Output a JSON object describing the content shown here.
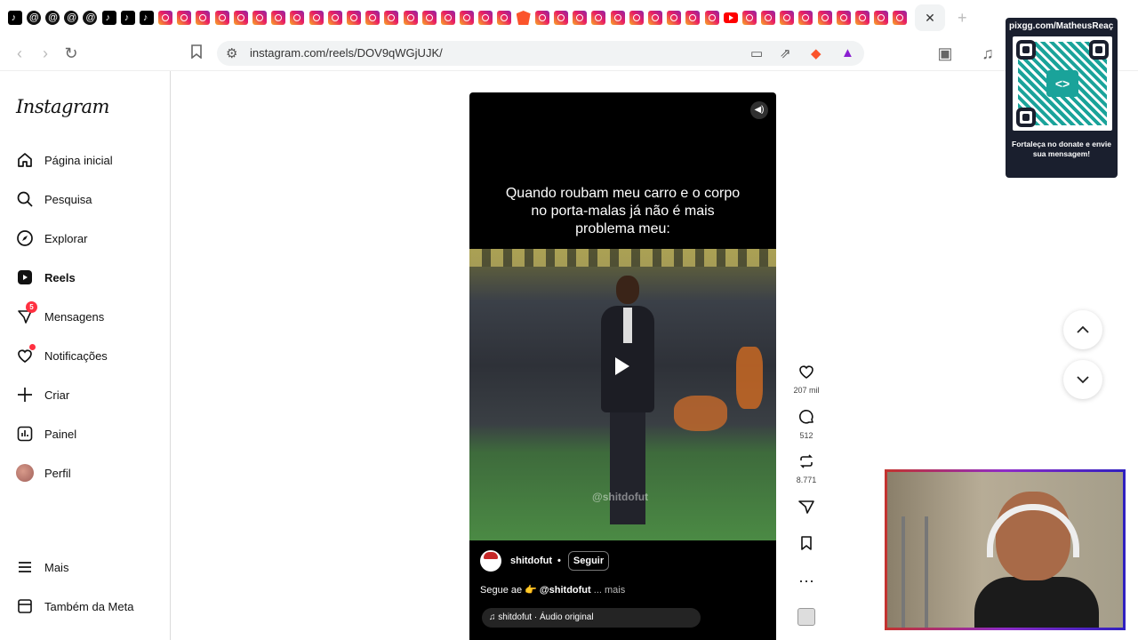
{
  "browser": {
    "tabs_icons": [
      "tiktok",
      "threads",
      "threads",
      "threads",
      "threads",
      "tiktok",
      "tiktok",
      "tiktok",
      "instagram",
      "instagram",
      "instagram",
      "instagram",
      "instagram",
      "instagram",
      "instagram",
      "instagram",
      "instagram",
      "instagram",
      "instagram",
      "instagram",
      "instagram",
      "instagram",
      "instagram",
      "instagram",
      "instagram",
      "instagram",
      "instagram",
      "brave",
      "instagram",
      "instagram",
      "instagram",
      "instagram",
      "instagram",
      "instagram",
      "instagram",
      "instagram",
      "instagram",
      "instagram",
      "youtube",
      "instagram",
      "instagram",
      "instagram",
      "instagram",
      "instagram",
      "instagram",
      "instagram",
      "instagram",
      "instagram"
    ],
    "close_tab": "✕",
    "new_tab": "+",
    "url": "instagram.com/reels/DOV9qWGjUJK/"
  },
  "sidebar": {
    "logo": "Instagram",
    "items": [
      {
        "label": "Página inicial",
        "icon": "home-icon"
      },
      {
        "label": "Pesquisa",
        "icon": "search-icon"
      },
      {
        "label": "Explorar",
        "icon": "compass-icon"
      },
      {
        "label": "Reels",
        "icon": "reels-icon"
      },
      {
        "label": "Mensagens",
        "icon": "messenger-icon",
        "badge": "5"
      },
      {
        "label": "Notificações",
        "icon": "heart-icon"
      },
      {
        "label": "Criar",
        "icon": "plus-icon"
      },
      {
        "label": "Painel",
        "icon": "dashboard-icon"
      },
      {
        "label": "Perfil",
        "icon": "avatar"
      }
    ],
    "more": "Mais",
    "meta": "Também da Meta"
  },
  "reel": {
    "caption": "Quando roubam meu carro e o corpo no porta-malas já não é mais problema meu:",
    "watermark": "@shitdofut",
    "username": "shitdofut",
    "separator": "•",
    "follow": "Seguir",
    "desc_prefix": "Segue ae 👉 ",
    "desc_mention": "@shitdofut",
    "desc_more": " ... mais",
    "audio": "♫ shitdofut · Áudio original"
  },
  "actions": {
    "likes": "207 mil",
    "comments": "512",
    "reposts": "8.771"
  },
  "overlay": {
    "qr_url": "pixgg.com/MatheusReaç",
    "qr_message": "Fortaleça no donate e envie sua mensagem!"
  }
}
